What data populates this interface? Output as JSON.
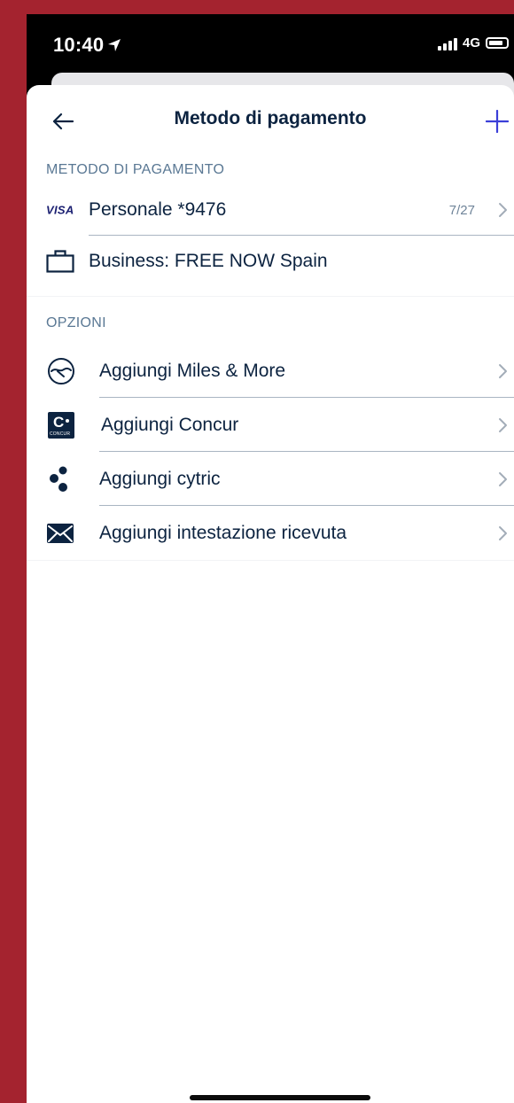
{
  "status_bar": {
    "time": "10:40",
    "network": "4G",
    "icons": [
      "location-arrow-icon",
      "signal-bars-icon",
      "battery-icon"
    ]
  },
  "nav": {
    "title": "Metodo di pagamento",
    "back_icon": "arrow-left-icon",
    "add_icon": "plus-icon"
  },
  "payment_section": {
    "header": "METODO DI PAGAMENTO",
    "items": [
      {
        "icon": "visa-logo",
        "logo_text": "VISA",
        "label": "Personale *9476",
        "expiry": "7/27",
        "chevron": true
      },
      {
        "icon": "briefcase-icon",
        "label": "Business: FREE NOW Spain",
        "chevron": false
      }
    ]
  },
  "options_section": {
    "header": "OPZIONI",
    "items": [
      {
        "icon": "lufthansa-crane-icon",
        "label": "Aggiungi Miles & More"
      },
      {
        "icon": "concur-logo-icon",
        "logo_text": "CONCUR",
        "label": "Aggiungi Concur"
      },
      {
        "icon": "cytric-dots-icon",
        "label": "Aggiungi cytric"
      },
      {
        "icon": "envelope-icon",
        "label": "Aggiungi intestazione ricevuta"
      }
    ]
  },
  "colors": {
    "background": "#a4232f",
    "primary_text": "#0c2340",
    "section_header": "#5a7894",
    "accent": "#3b3fd8",
    "separator": "#a9b5c2"
  }
}
